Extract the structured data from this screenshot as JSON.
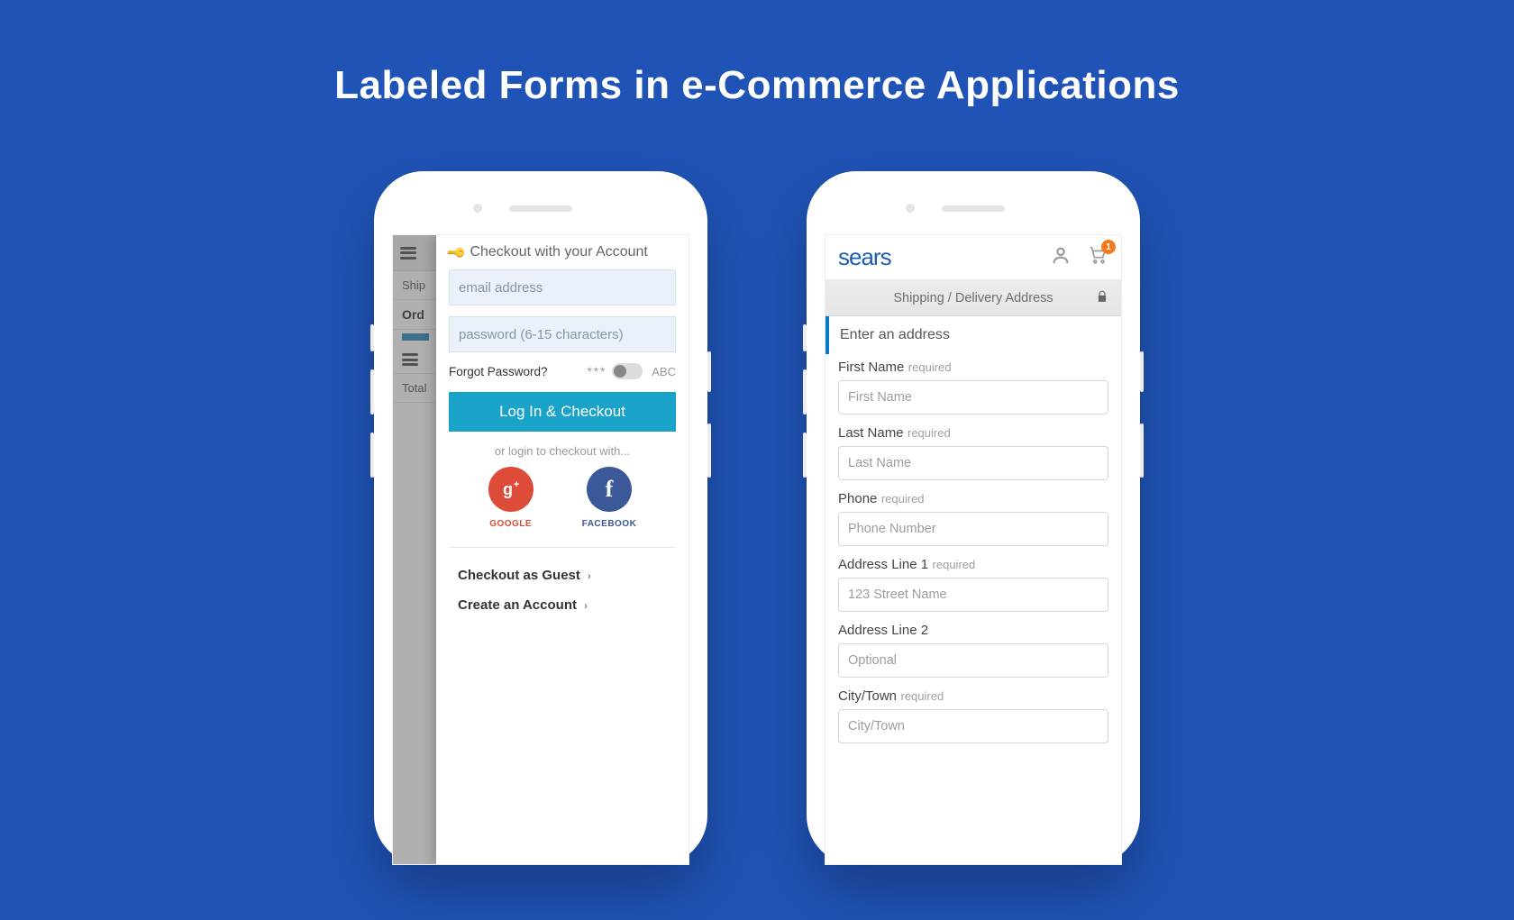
{
  "page_title": "Labeled Forms in e-Commerce Applications",
  "phone1": {
    "bg": {
      "ship_label": "Ship",
      "order_label": "Ord",
      "total_label": "Total"
    },
    "modal_title": "Checkout with your Account",
    "email_placeholder": "email address",
    "password_placeholder": "password (6-15 characters)",
    "forgot_label": "Forgot Password?",
    "mask_stars": "***",
    "abc_label": "ABC",
    "login_button": "Log In & Checkout",
    "or_text": "or login to checkout with...",
    "google_label": "GOOGLE",
    "facebook_label": "FACEBOOK",
    "guest_link": "Checkout as Guest",
    "create_link": "Create an Account"
  },
  "phone2": {
    "brand": "sears",
    "cart_count": "1",
    "sub_title": "Shipping / Delivery Address",
    "section_label": "Enter an address",
    "fields": {
      "first_name_label": "First Name",
      "first_name_req": "required",
      "first_name_ph": "First Name",
      "last_name_label": "Last Name",
      "last_name_req": "required",
      "last_name_ph": "Last Name",
      "phone_label": "Phone",
      "phone_req": "required",
      "phone_ph": "Phone Number",
      "addr1_label": "Address Line 1",
      "addr1_req": "required",
      "addr1_ph": "123 Street Name",
      "addr2_label": "Address Line 2",
      "addr2_ph": "Optional",
      "city_label": "City/Town",
      "city_req": "required",
      "city_ph": "City/Town"
    }
  }
}
